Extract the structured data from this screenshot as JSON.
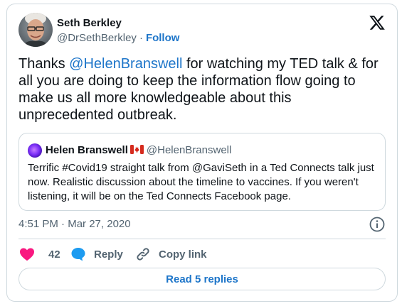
{
  "author": {
    "display_name": "Seth Berkley",
    "handle": "@DrSethBerkley",
    "separator": "·",
    "follow_label": "Follow"
  },
  "tweet": {
    "text_before": "Thanks ",
    "mention": "@HelenBranswell",
    "text_after": " for watching my TED talk & for all you are doing to keep the information flow going to make us all more knowledgeable about this unprecedented outbreak."
  },
  "quoted": {
    "display_name": "Helen Branswell",
    "handle": "@HelenBranswell",
    "text": "Terrific #Covid19 straight talk from @GaviSeth in a Ted Connects talk just now. Realistic discussion about the timeline to vaccines. If you weren't listening, it will be on the Ted Connects Facebook page."
  },
  "meta": {
    "time": "4:51 PM",
    "separator": "·",
    "date": "Mar 27, 2020"
  },
  "actions": {
    "like_count": "42",
    "reply_label": "Reply",
    "copy_link_label": "Copy link"
  },
  "footer": {
    "read_replies_label": "Read 5 replies"
  },
  "colors": {
    "link": "#1d75c9",
    "heart": "#f91880",
    "reply_bubble": "#1d9bf0",
    "secondary_text": "#536471"
  }
}
